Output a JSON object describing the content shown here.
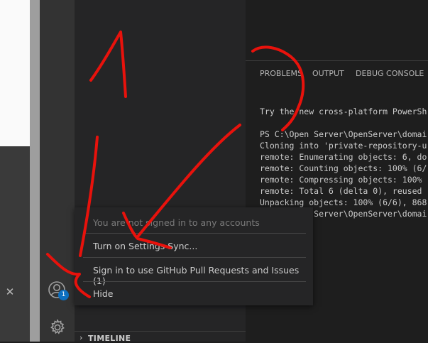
{
  "external": {
    "close_glyph": "✕"
  },
  "panel": {
    "tabs": [
      "PROBLEMS",
      "OUTPUT",
      "DEBUG CONSOLE"
    ]
  },
  "terminal": {
    "lines": [
      "Try the new cross-platform PowerSh",
      "",
      "PS C:\\Open Server\\OpenServer\\domai",
      "Cloning into 'private-repository-u",
      "remote: Enumerating objects: 6, do",
      "remote: Counting objects: 100% (6/",
      "remote: Compressing objects: 100% ",
      "remote: Total 6 (delta 0), reused ",
      "Unpacking objects: 100% (6/6), 868",
      "PS C:\\Open Server\\OpenServer\\domai"
    ]
  },
  "sidebar": {
    "timeline_label": "TIMELINE",
    "timeline_chevron": "›"
  },
  "accounts": {
    "badge": "1"
  },
  "menu": {
    "header": "You are not signed in to any accounts",
    "items": [
      "Turn on Settings Sync...",
      "Sign in to use GitHub Pull Requests and Issues (1)",
      "Hide"
    ]
  },
  "colors": {
    "annotation": "#e8120c",
    "badge": "#0e70c0"
  }
}
